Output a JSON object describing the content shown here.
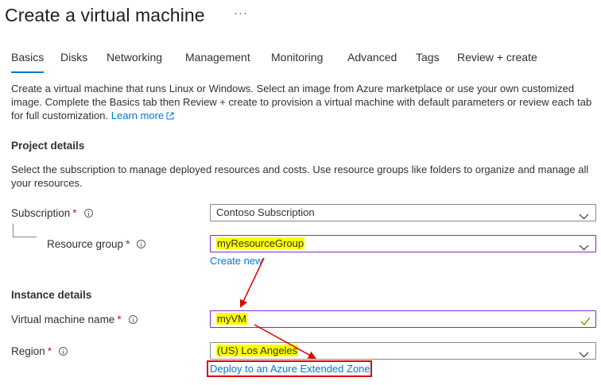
{
  "header": {
    "title": "Create a virtual machine",
    "more": "···"
  },
  "tabs": [
    {
      "label": "Basics",
      "active": true
    },
    {
      "label": "Disks"
    },
    {
      "label": "Networking"
    },
    {
      "label": "Management"
    },
    {
      "label": "Monitoring"
    },
    {
      "label": "Advanced"
    },
    {
      "label": "Tags"
    },
    {
      "label": "Review + create"
    }
  ],
  "intro": {
    "text": "Create a virtual machine that runs Linux or Windows. Select an image from Azure marketplace or use your own customized image. Complete the Basics tab then Review + create to provision a virtual machine with default parameters or review each tab for full customization.",
    "learn_more": "Learn more",
    "learn_more_icon": "external-link-icon"
  },
  "project_details": {
    "heading": "Project details",
    "description": "Select the subscription to manage deployed resources and costs. Use resource groups like folders to organize and manage all your resources.",
    "subscription": {
      "label": "Subscription",
      "required": "*",
      "value": "Contoso Subscription"
    },
    "resource_group": {
      "label": "Resource group",
      "required": "*",
      "value": "myResourceGroup",
      "create_new": "Create new"
    }
  },
  "instance_details": {
    "heading": "Instance details",
    "vm_name": {
      "label": "Virtual machine name",
      "required": "*",
      "value": "myVM"
    },
    "region": {
      "label": "Region",
      "required": "*",
      "value": "(US) Los Angeles",
      "extended_zone_link": "Deploy to an Azure Extended Zone"
    }
  },
  "colors": {
    "accent": "#0078d4",
    "highlight": "#ffff00",
    "annotation_red": "#e00000",
    "focus_border": "#7b2cc7",
    "valid_check": "#57a300",
    "required": "#a4262c"
  }
}
